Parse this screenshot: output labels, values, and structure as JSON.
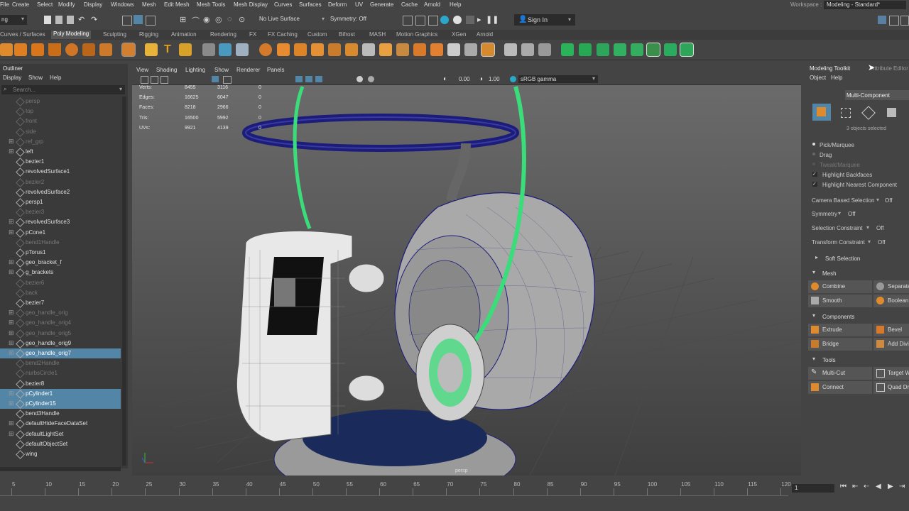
{
  "menubar": {
    "items": [
      "File",
      "Create",
      "Select",
      "Modify",
      "Display",
      "Windows",
      "Mesh",
      "Edit Mesh",
      "Mesh Tools",
      "Mesh Display",
      "Curves",
      "Surfaces",
      "Deform",
      "UV",
      "Generate",
      "Cache",
      "Arnold",
      "Help"
    ],
    "workspace_label": "Workspace :",
    "workspace_value": "Modeling - Standard*"
  },
  "statusline": {
    "mode_value": "ng",
    "live_surface": "No Live Surface",
    "symmetry": "Symmetry: Off",
    "sign_in": "Sign In"
  },
  "shelf_tabs": {
    "items": [
      "Curves / Surfaces",
      "Poly Modeling",
      "Sculpting",
      "Rigging",
      "Animation",
      "Rendering",
      "FX",
      "FX Caching",
      "Custom",
      "Bifrost",
      "MASH",
      "Motion Graphics",
      "XGen",
      "Arnold"
    ],
    "active": "Poly Modeling"
  },
  "outliner": {
    "title": "Outliner",
    "menu": [
      "Display",
      "Show",
      "Help"
    ],
    "search_placeholder": "Search...",
    "items": [
      {
        "label": "persp"
      },
      {
        "label": "top"
      },
      {
        "label": "front"
      },
      {
        "label": "side"
      },
      {
        "label": "ref_grp"
      },
      {
        "label": "left"
      },
      {
        "label": "bezier1"
      },
      {
        "label": "revolvedSurface1"
      },
      {
        "label": "bezier2"
      },
      {
        "label": "revolvedSurface2"
      },
      {
        "label": "persp1"
      },
      {
        "label": "bezier3"
      },
      {
        "label": "revolvedSurface3"
      },
      {
        "label": "pCone1"
      },
      {
        "label": "bend1Handle"
      },
      {
        "label": "pTorus1"
      },
      {
        "label": "geo_bracket_f"
      },
      {
        "label": "g_brackets"
      },
      {
        "label": "bezier6"
      },
      {
        "label": "back"
      },
      {
        "label": "bezier7"
      },
      {
        "label": "geo_handle_orig"
      },
      {
        "label": "geo_handle_orig4"
      },
      {
        "label": "geo_handle_orig5"
      },
      {
        "label": "geo_handle_orig9"
      },
      {
        "label": "geo_handle_orig7"
      },
      {
        "label": "bend2Handle"
      },
      {
        "label": "nurbsCircle1"
      },
      {
        "label": "bezier8"
      },
      {
        "label": "pCylinder1"
      },
      {
        "label": "pCylinder15"
      },
      {
        "label": "bend3Handle"
      },
      {
        "label": "defaultHideFaceDataSet"
      },
      {
        "label": "defaultLightSet"
      },
      {
        "label": "defaultObjectSet"
      },
      {
        "label": "wing"
      }
    ]
  },
  "viewport": {
    "menu": [
      "View",
      "Shading",
      "Lighting",
      "Show",
      "Renderer",
      "Panels"
    ],
    "exposure": "0.00",
    "gamma": "1.00",
    "color_space": "sRGB gamma",
    "camera_label": "persp",
    "hud": [
      {
        "name": "Verts:",
        "a": "8455",
        "b": "3116",
        "c": "0"
      },
      {
        "name": "Edges:",
        "a": "16625",
        "b": "6047",
        "c": "0"
      },
      {
        "name": "Faces:",
        "a": "8218",
        "b": "2966",
        "c": "0"
      },
      {
        "name": "Tris:",
        "a": "16500",
        "b": "5992",
        "c": "0"
      },
      {
        "name": "UVs:",
        "a": "9921",
        "b": "4139",
        "c": "0"
      }
    ]
  },
  "toolkit": {
    "tab_title": "Modeling Toolkit",
    "tab_other": "Attribute Editor",
    "menu": [
      "Object",
      "Help"
    ],
    "mode": "Multi-Component",
    "selection_status": "3 objects selected",
    "options": {
      "pick_marquee": "Pick/Marquee",
      "drag": "Drag",
      "tweak_marquee": "Tweak/Marquee",
      "highlight_backfaces": "Highlight Backfaces",
      "highlight_nearest": "Highlight Nearest Component"
    },
    "settings": [
      {
        "label": "Camera Based Selection",
        "value": "Off"
      },
      {
        "label": "Symmetry",
        "value": "Off"
      },
      {
        "label": "Selection Constraint",
        "value": "Off"
      },
      {
        "label": "Transform Constraint",
        "value": "Off"
      }
    ],
    "soft_selection": "Soft Selection",
    "sections": {
      "mesh": {
        "title": "Mesh",
        "buttons": [
          "Combine",
          "Separate",
          "Smooth",
          "Boolean"
        ]
      },
      "components": {
        "title": "Components",
        "buttons": [
          "Extrude",
          "Bevel",
          "Bridge",
          "Add Divisions"
        ]
      },
      "tools": {
        "title": "Tools",
        "buttons": [
          "Multi-Cut",
          "Target Weld",
          "Connect",
          "Quad Draw"
        ]
      }
    }
  },
  "timeline": {
    "ticks": [
      "5",
      "10",
      "15",
      "20",
      "25",
      "30",
      "35",
      "40",
      "45",
      "50",
      "55",
      "60",
      "65",
      "70",
      "75",
      "80",
      "85",
      "90",
      "95",
      "100",
      "105",
      "110",
      "115",
      "120"
    ],
    "current_frame": "1"
  },
  "colors": {
    "selection_blue": "#5285a6",
    "wire_blue": "#1c1c7a",
    "highlight_green": "#3bdc7a",
    "panel_bg": "#444444"
  }
}
